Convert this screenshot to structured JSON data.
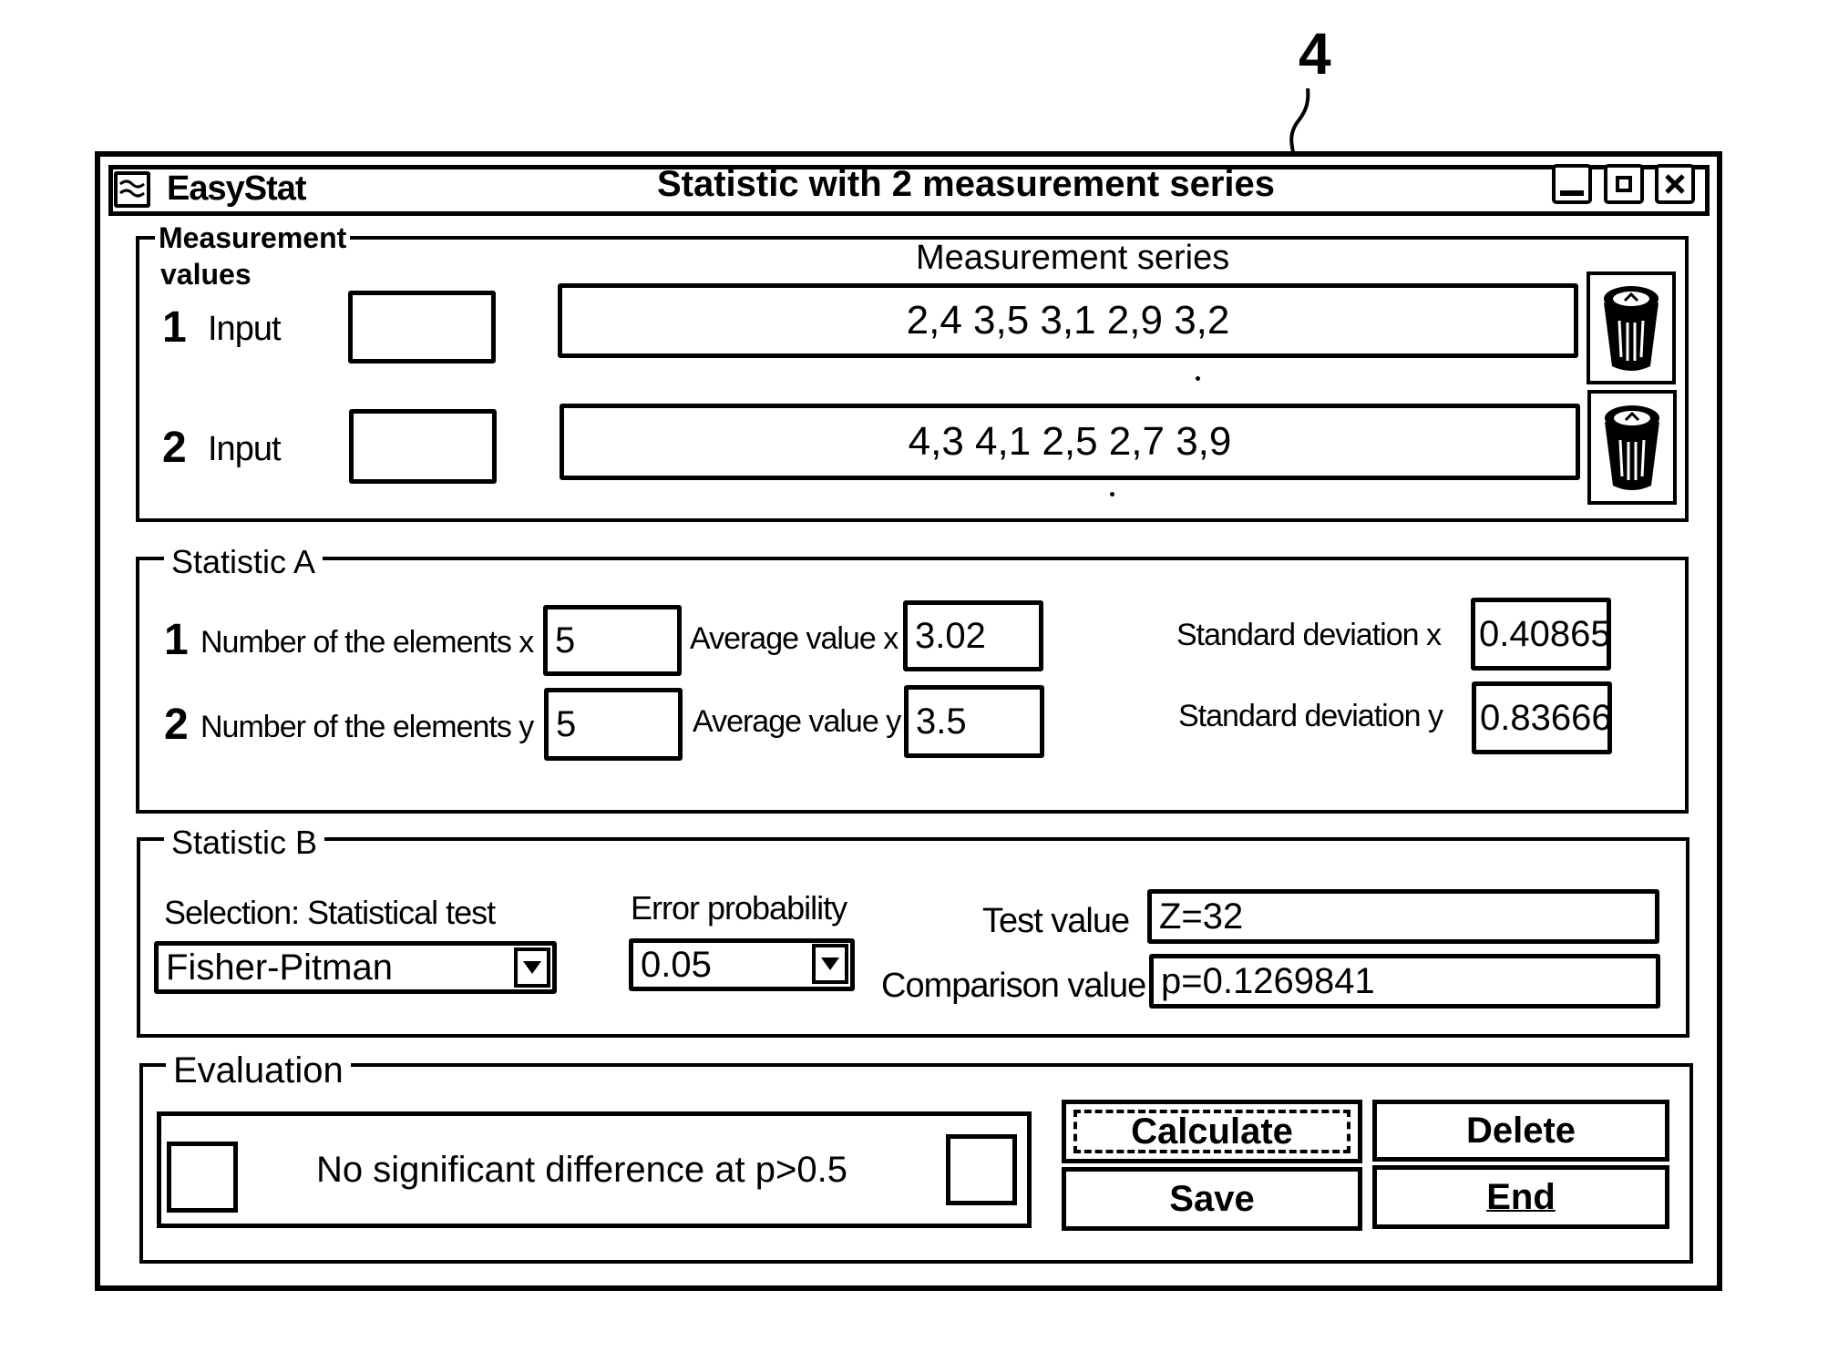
{
  "figure": {
    "reference_numeral": "4"
  },
  "window": {
    "app_name": "EasyStat",
    "title": "Statistic with 2 measurement series",
    "controls": {
      "minimize": "minimize-icon",
      "maximize": "maximize-icon",
      "close": "close-icon"
    }
  },
  "measurement": {
    "legend_line1": "Measurement",
    "legend_line2": "values",
    "series_header": "Measurement series",
    "rows": [
      {
        "index": "1",
        "label": "Input",
        "input_value": "",
        "series": "2,4 3,5 3,1 2,9 3,2",
        "delete_icon": "trash-icon"
      },
      {
        "index": "2",
        "label": "Input",
        "input_value": "",
        "series": "4,3 4,1 2,5 2,7 3,9",
        "delete_icon": "trash-icon"
      }
    ]
  },
  "statistic_a": {
    "legend": "Statistic A",
    "rows": [
      {
        "index": "1",
        "count_label": "Number of the elements x",
        "count": "5",
        "avg_label": "Average value x",
        "avg": "3.02",
        "sd_label": "Standard deviation x",
        "sd": "0.40865"
      },
      {
        "index": "2",
        "count_label": "Number of the elements y",
        "count": "5",
        "avg_label": "Average value y",
        "avg": "3.5",
        "sd_label": "Standard deviation y",
        "sd": "0.83666"
      }
    ]
  },
  "statistic_b": {
    "legend": "Statistic B",
    "test_label": "Selection: Statistical test",
    "test_selected": "Fisher-Pitman",
    "error_label": "Error probability",
    "error_selected": "0.05",
    "test_value_label": "Test value",
    "test_value": "Z=32",
    "comparison_label": "Comparison value",
    "comparison_value": "p=0.1269841"
  },
  "evaluation": {
    "legend": "Evaluation",
    "result_text": "No significant difference at p>0.5",
    "buttons": {
      "calculate": "Calculate",
      "delete": "Delete",
      "save": "Save",
      "end": "End"
    }
  }
}
